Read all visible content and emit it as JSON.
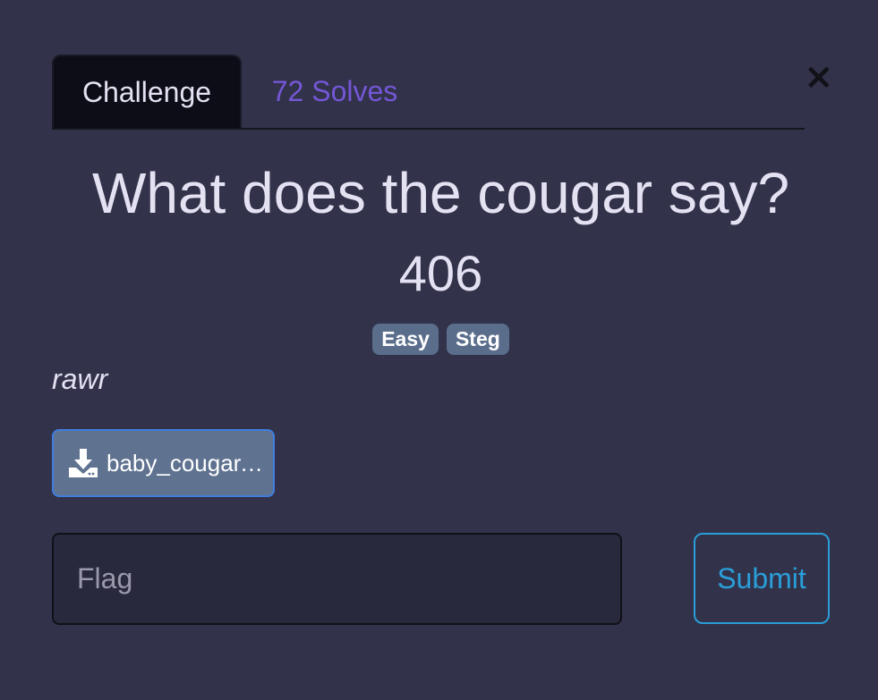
{
  "modal": {
    "close_label": "×",
    "tabs": [
      {
        "label": "Challenge",
        "active": true
      },
      {
        "label": "72 Solves",
        "active": false
      }
    ],
    "challenge": {
      "name": "What does the cougar say?",
      "points": "406",
      "tags": [
        "Easy",
        "Steg"
      ],
      "description": "rawr",
      "file": {
        "name": "baby_cougar.png",
        "icon": "download-icon"
      }
    },
    "flag_input": {
      "value": "",
      "placeholder": "Flag"
    },
    "submit_label": "Submit",
    "colors": {
      "background": "#32324a",
      "active_tab": "#0d0d17",
      "solves_link": "#7457d6",
      "tag_bg": "#5a6e8c",
      "file_button": "#5f7290",
      "submit": "#2a9ed8"
    }
  }
}
